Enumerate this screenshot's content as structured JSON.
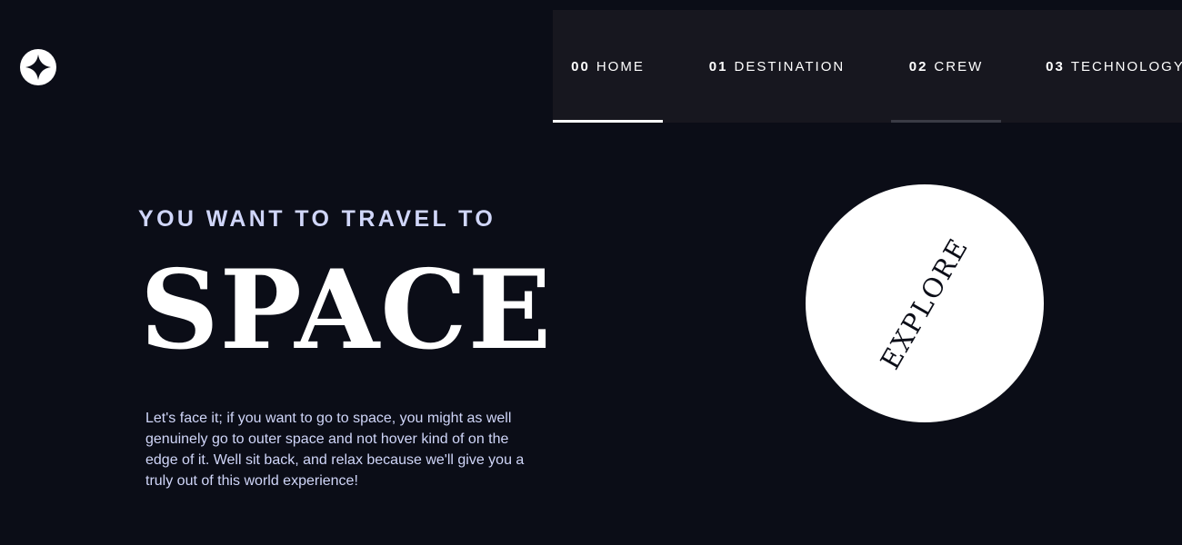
{
  "logo": {
    "icon": "star-logo-icon"
  },
  "nav": {
    "items": [
      {
        "num": "00",
        "label": "HOME",
        "state": "active"
      },
      {
        "num": "01",
        "label": "DESTINATION",
        "state": "default"
      },
      {
        "num": "02",
        "label": "CREW",
        "state": "hovered"
      },
      {
        "num": "03",
        "label": "TECHNOLOGY",
        "state": "default"
      }
    ]
  },
  "hero": {
    "subtitle": "YOU WANT TO TRAVEL TO",
    "title": "SPACE",
    "description": "Let's face it; if you want to go to space, you might as well genuinely go to outer space and not hover kind of on the edge of it. Well sit back, and relax because we'll give you a truly out of this world experience!"
  },
  "explore": {
    "label": "EXPLORE"
  },
  "colors": {
    "background": "#0b0d17",
    "nav_background": "#17171f",
    "text_light_blue": "#d0d6f9",
    "white": "#ffffff"
  }
}
